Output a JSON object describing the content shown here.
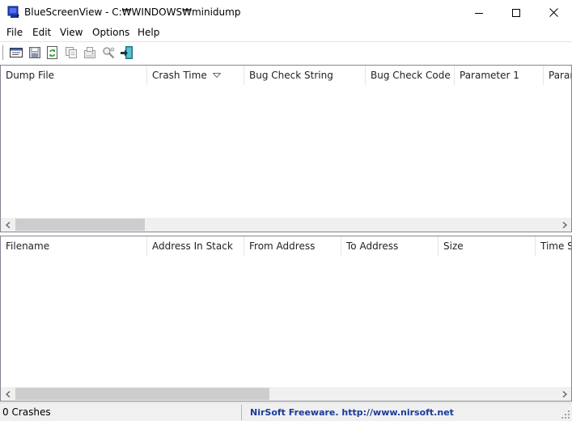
{
  "window": {
    "app_name": "BlueScreenView",
    "separator": "-",
    "path": "C:₩WINDOWS₩minidump",
    "title": "BlueScreenView  -  C:₩WINDOWS₩minidump"
  },
  "menu": {
    "items": [
      "File",
      "Edit",
      "View",
      "Options",
      "Help"
    ]
  },
  "toolbar": {
    "buttons": [
      {
        "icon": "properties-window-icon"
      },
      {
        "icon": "save-icon"
      },
      {
        "icon": "refresh-icon"
      },
      {
        "icon": "copy-icon"
      },
      {
        "icon": "html-report-icon"
      },
      {
        "icon": "find-icon"
      },
      {
        "icon": "exit-icon"
      }
    ]
  },
  "top_list": {
    "columns": [
      "Dump File",
      "Crash Time",
      "Bug Check String",
      "Bug Check Code",
      "Parameter 1",
      "Param"
    ],
    "sorted_column": "Crash Time",
    "sort_direction": "descending",
    "rows": []
  },
  "bottom_list": {
    "columns": [
      "Filename",
      "Address In Stack",
      "From Address",
      "To Address",
      "Size",
      "Time S"
    ],
    "rows": []
  },
  "status": {
    "count_text": "0 Crashes",
    "link_text": "NirSoft Freeware.  http://www.nirsoft.net"
  },
  "colors": {
    "link": "#1a3a9b",
    "pane_border": "#828790",
    "scroll_thumb": "#cdcdcd",
    "app_icon_blue": "#1e3fb0"
  }
}
